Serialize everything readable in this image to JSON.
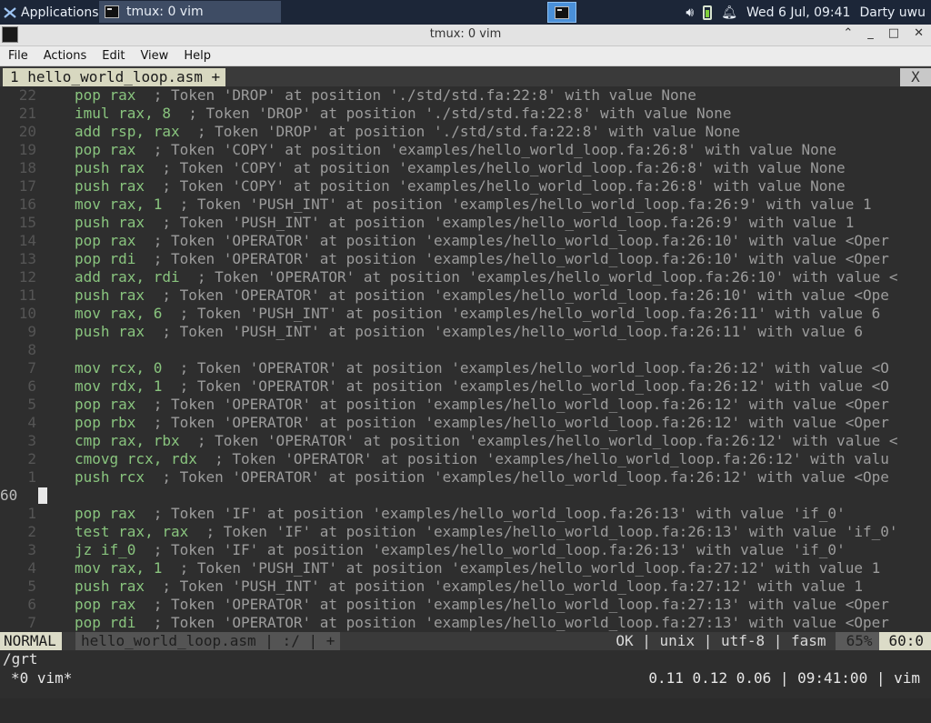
{
  "panel": {
    "applications_label": "Applications",
    "task_label": "tmux: 0 vim",
    "datetime": "Wed  6 Jul, 09:41",
    "user": "Darty uwu"
  },
  "window": {
    "title": "tmux: 0 vim",
    "menu": [
      "File",
      "Actions",
      "Edit",
      "View",
      "Help"
    ]
  },
  "vim": {
    "tab_label": "1 hello_world_loop.asm +",
    "tab_close": "X",
    "current_line_number": "60",
    "lines": [
      {
        "n": "22",
        "i": "pop rax",
        "c": "  ; Token 'DROP' at position './std/std.fa:22:8' with value None"
      },
      {
        "n": "21",
        "i": "imul rax, 8",
        "c": "  ; Token 'DROP' at position './std/std.fa:22:8' with value None"
      },
      {
        "n": "20",
        "i": "add rsp, rax",
        "c": "  ; Token 'DROP' at position './std/std.fa:22:8' with value None"
      },
      {
        "n": "19",
        "i": "pop rax",
        "c": "  ; Token 'COPY' at position 'examples/hello_world_loop.fa:26:8' with value None"
      },
      {
        "n": "18",
        "i": "push rax",
        "c": "  ; Token 'COPY' at position 'examples/hello_world_loop.fa:26:8' with value None"
      },
      {
        "n": "17",
        "i": "push rax",
        "c": "  ; Token 'COPY' at position 'examples/hello_world_loop.fa:26:8' with value None"
      },
      {
        "n": "16",
        "i": "mov rax, 1",
        "c": "  ; Token 'PUSH_INT' at position 'examples/hello_world_loop.fa:26:9' with value 1"
      },
      {
        "n": "15",
        "i": "push rax",
        "c": "  ; Token 'PUSH_INT' at position 'examples/hello_world_loop.fa:26:9' with value 1"
      },
      {
        "n": "14",
        "i": "pop rax",
        "c": "  ; Token 'OPERATOR' at position 'examples/hello_world_loop.fa:26:10' with value <Oper"
      },
      {
        "n": "13",
        "i": "pop rdi",
        "c": "  ; Token 'OPERATOR' at position 'examples/hello_world_loop.fa:26:10' with value <Oper"
      },
      {
        "n": "12",
        "i": "add rax, rdi",
        "c": "  ; Token 'OPERATOR' at position 'examples/hello_world_loop.fa:26:10' with value <"
      },
      {
        "n": "11",
        "i": "push rax",
        "c": "  ; Token 'OPERATOR' at position 'examples/hello_world_loop.fa:26:10' with value <Ope"
      },
      {
        "n": "10",
        "i": "mov rax, 6",
        "c": "  ; Token 'PUSH_INT' at position 'examples/hello_world_loop.fa:26:11' with value 6"
      },
      {
        "n": "9",
        "i": "push rax",
        "c": "  ; Token 'PUSH_INT' at position 'examples/hello_world_loop.fa:26:11' with value 6"
      },
      {
        "n": "8",
        "i": "",
        "c": ""
      },
      {
        "n": "7",
        "i": "mov rcx, 0",
        "c": "  ; Token 'OPERATOR' at position 'examples/hello_world_loop.fa:26:12' with value <O"
      },
      {
        "n": "6",
        "i": "mov rdx, 1",
        "c": "  ; Token 'OPERATOR' at position 'examples/hello_world_loop.fa:26:12' with value <O"
      },
      {
        "n": "5",
        "i": "pop rax",
        "c": "  ; Token 'OPERATOR' at position 'examples/hello_world_loop.fa:26:12' with value <Oper"
      },
      {
        "n": "4",
        "i": "pop rbx",
        "c": "  ; Token 'OPERATOR' at position 'examples/hello_world_loop.fa:26:12' with value <Oper"
      },
      {
        "n": "3",
        "i": "cmp rax, rbx",
        "c": "  ; Token 'OPERATOR' at position 'examples/hello_world_loop.fa:26:12' with value <"
      },
      {
        "n": "2",
        "i": "cmovg rcx, rdx",
        "c": "  ; Token 'OPERATOR' at position 'examples/hello_world_loop.fa:26:12' with valu"
      },
      {
        "n": "1",
        "i": "push rcx",
        "c": "  ; Token 'OPERATOR' at position 'examples/hello_world_loop.fa:26:12' with value <Ope"
      },
      {
        "n": "60",
        "i": "",
        "c": "",
        "current": true
      },
      {
        "n": "1",
        "i": "pop rax",
        "c": "  ; Token 'IF' at position 'examples/hello_world_loop.fa:26:13' with value 'if_0'"
      },
      {
        "n": "2",
        "i": "test rax, rax",
        "c": "  ; Token 'IF' at position 'examples/hello_world_loop.fa:26:13' with value 'if_0'"
      },
      {
        "n": "3",
        "i": "jz if_0",
        "c": "  ; Token 'IF' at position 'examples/hello_world_loop.fa:26:13' with value 'if_0'"
      },
      {
        "n": "4",
        "i": "mov rax, 1",
        "c": "  ; Token 'PUSH_INT' at position 'examples/hello_world_loop.fa:27:12' with value 1"
      },
      {
        "n": "5",
        "i": "push rax",
        "c": "  ; Token 'PUSH_INT' at position 'examples/hello_world_loop.fa:27:12' with value 1"
      },
      {
        "n": "6",
        "i": "pop rax",
        "c": "  ; Token 'OPERATOR' at position 'examples/hello_world_loop.fa:27:13' with value <Oper"
      },
      {
        "n": "7",
        "i": "pop rdi",
        "c": "  ; Token 'OPERATOR' at position 'examples/hello_world_loop.fa:27:13' with value <Oper"
      }
    ],
    "status": {
      "mode": "NORMAL",
      "file": "hello_world_loop.asm | :/ | +",
      "info": "OK | unix | utf-8 | fasm",
      "percent": "65%",
      "position": "60:0"
    },
    "cmdline": "/grt"
  },
  "tmux": {
    "window": " *0 vim*",
    "right": "0.11 0.12 0.06 | 09:41:00 | vim"
  }
}
